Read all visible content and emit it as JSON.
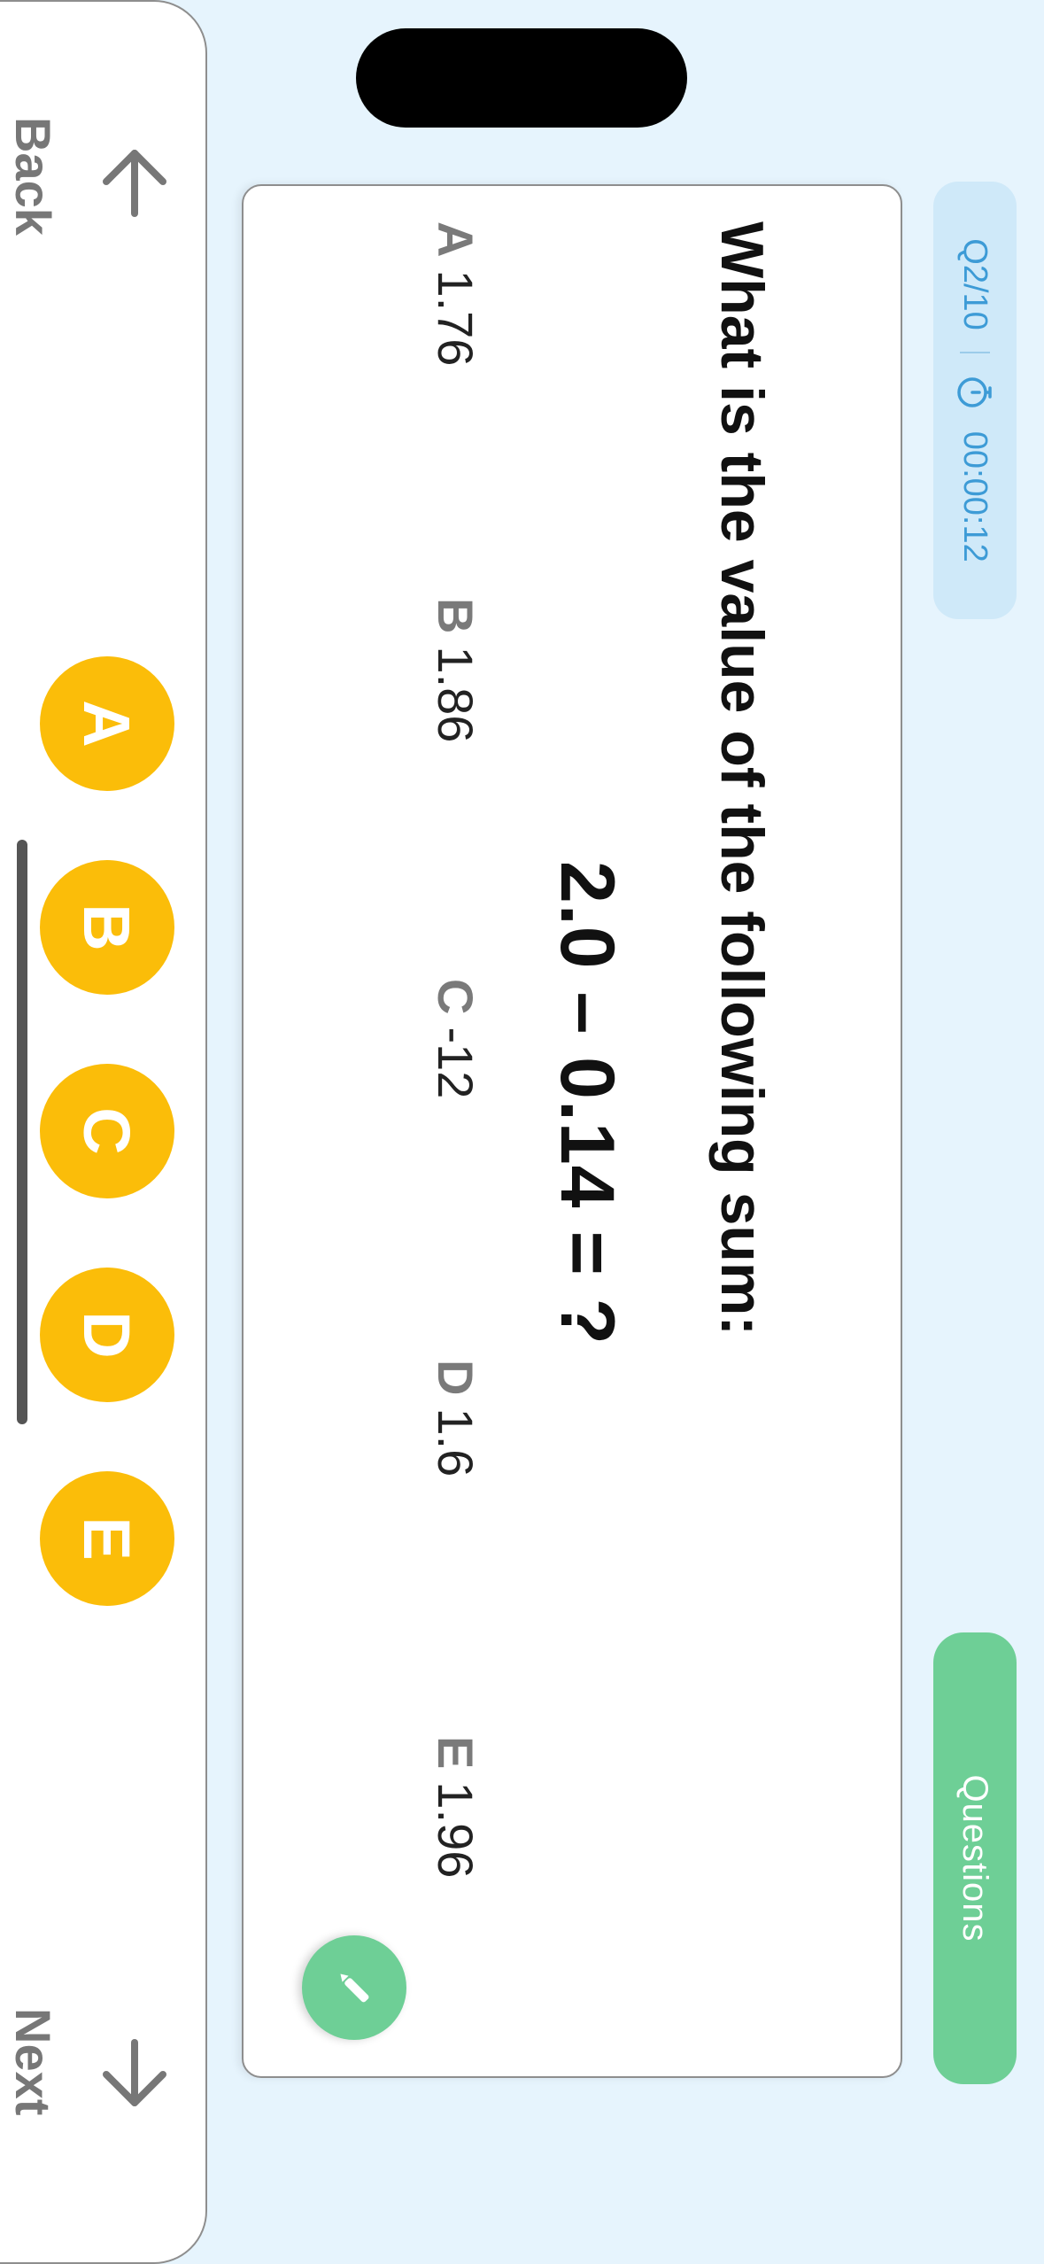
{
  "header": {
    "question_counter": "Q2/10",
    "timer": "00:00:12",
    "questions_button": "Questions"
  },
  "question": {
    "title": "What is the value of the following sum:",
    "equation": "2.0 – 0.14 = ?"
  },
  "choices": [
    {
      "letter": "A",
      "value": "1.76"
    },
    {
      "letter": "B",
      "value": "1.86"
    },
    {
      "letter": "C",
      "value": "-12"
    },
    {
      "letter": "D",
      "value": "1.6"
    },
    {
      "letter": "E",
      "value": "1.96"
    }
  ],
  "answer_buttons": [
    "A",
    "B",
    "C",
    "D",
    "E"
  ],
  "nav": {
    "back_label": "Back",
    "next_label": "Next"
  },
  "colors": {
    "background": "#e6f4fd",
    "accent_blue": "#3d9bd6",
    "accent_green": "#6ecf96",
    "answer_yellow": "#fbbd09"
  },
  "icons": [
    "timer-icon",
    "pencil-icon",
    "arrow-left-icon",
    "arrow-right-icon"
  ]
}
